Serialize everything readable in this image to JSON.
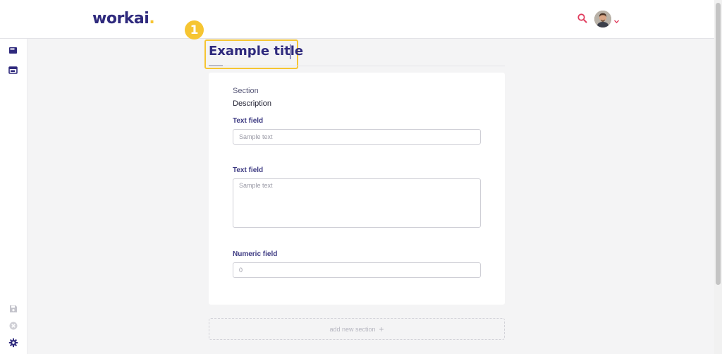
{
  "app": {
    "logo_text": "workai",
    "logo_dot": "."
  },
  "header": {
    "search_icon": "search-icon",
    "avatar_icon": "user-avatar",
    "caret_icon": "chevron-down-icon"
  },
  "annotation": {
    "marker_number": "1"
  },
  "page": {
    "title": "Example title"
  },
  "form": {
    "section_label": "Section",
    "description": "Description",
    "text_field_1": {
      "label": "Text field",
      "placeholder": "Sample text",
      "value": ""
    },
    "text_field_2": {
      "label": "Text field",
      "placeholder": "Sample text",
      "value": ""
    },
    "numeric_field": {
      "label": "Numeric field",
      "placeholder": "0",
      "value": ""
    },
    "add_section_label": "add new section",
    "add_section_icon": "plus-icon"
  },
  "sidebar": {
    "top_items": [
      {
        "icon": "page-icon"
      },
      {
        "icon": "layout-icon"
      }
    ],
    "bottom_items": [
      {
        "icon": "save-icon"
      },
      {
        "icon": "cancel-icon"
      },
      {
        "icon": "gear-icon"
      }
    ]
  },
  "colors": {
    "brand": "#2f2a7d",
    "accent_yellow": "#f6c532",
    "accent_red": "#e03a5c",
    "background": "#f4f4f5"
  }
}
